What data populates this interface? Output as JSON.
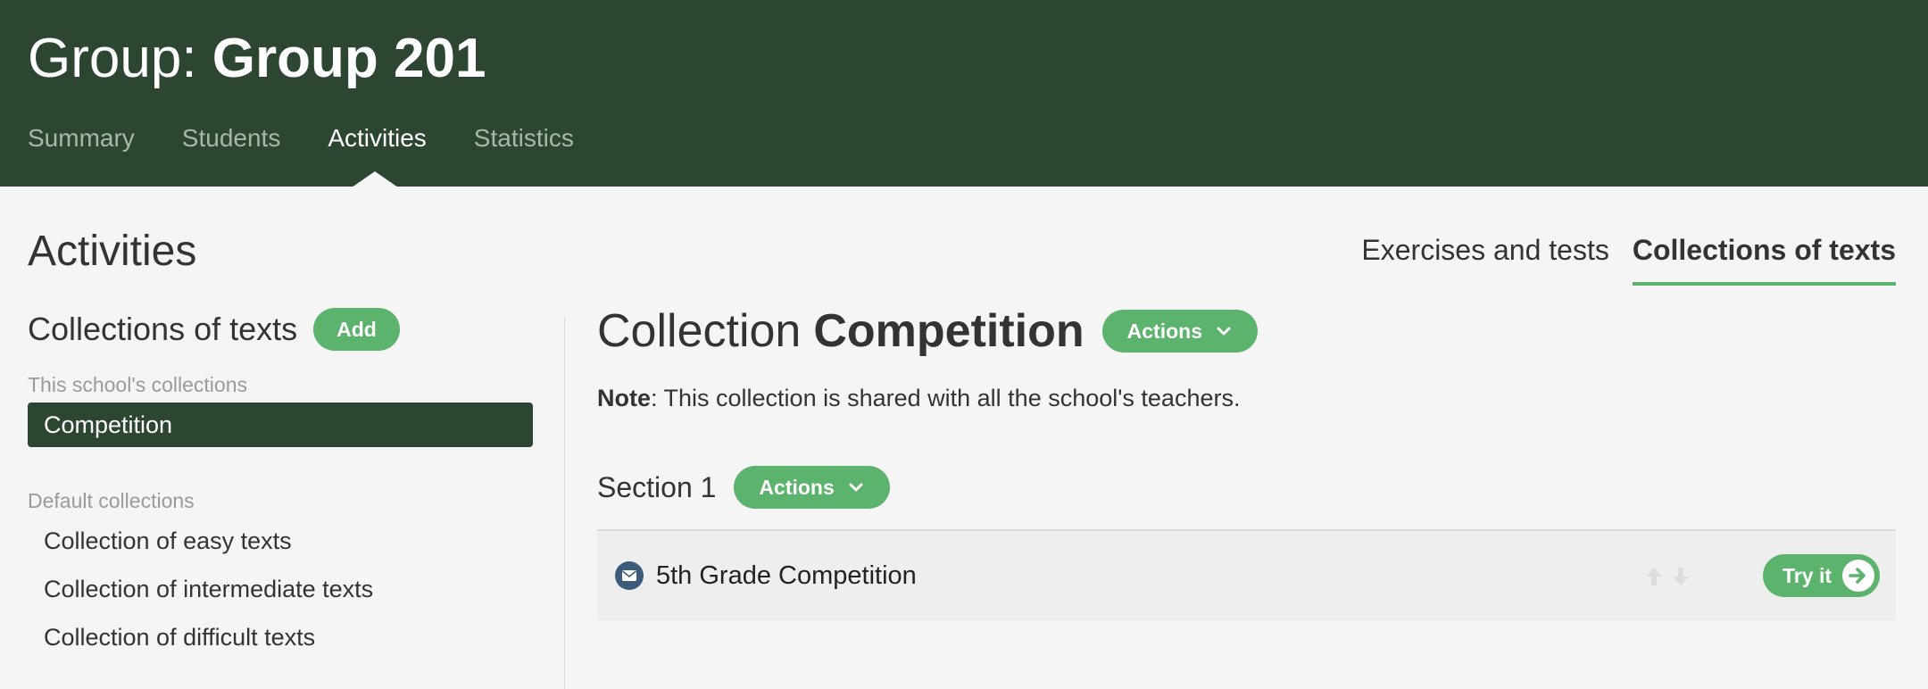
{
  "header": {
    "title_prefix": "Group:",
    "group_name": "Group 201",
    "tabs": [
      {
        "label": "Summary"
      },
      {
        "label": "Students"
      },
      {
        "label": "Activities"
      },
      {
        "label": "Statistics"
      }
    ],
    "active_tab": "Activities"
  },
  "page": {
    "title": "Activities",
    "view_tabs": [
      {
        "label": "Exercises and tests"
      },
      {
        "label": "Collections of texts"
      }
    ],
    "active_view": "Collections of texts"
  },
  "sidebar": {
    "heading": "Collections of texts",
    "add_label": "Add",
    "groups": [
      {
        "label": "This school's collections",
        "items": [
          {
            "label": "Competition"
          }
        ]
      },
      {
        "label": "Default collections",
        "items": [
          {
            "label": "Collection of easy texts"
          },
          {
            "label": "Collection of intermediate texts"
          },
          {
            "label": "Collection of difficult texts"
          }
        ]
      }
    ],
    "selected": "Competition"
  },
  "main": {
    "collection_label": "Collection",
    "collection_name": "Competition",
    "actions_label": "Actions",
    "note_label": "Note",
    "note_text": ": This collection is shared with all the school's teachers.",
    "sections": [
      {
        "title": "Section 1",
        "actions_label": "Actions",
        "items": [
          {
            "title": "5th Grade Competition",
            "icon": "envelope-icon",
            "try_label": "Try it"
          }
        ]
      }
    ]
  },
  "colors": {
    "header_bg": "#2c4631",
    "accent": "#5cb36d",
    "selected_bg": "#2c4631",
    "icon_bg": "#3c5a7a"
  }
}
